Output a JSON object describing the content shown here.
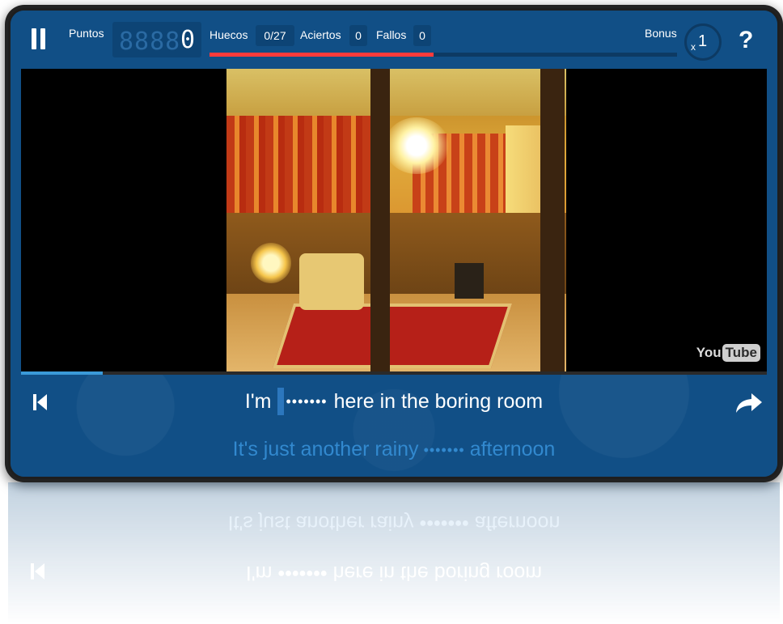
{
  "header": {
    "points_label": "Puntos",
    "points_ghost": "8888",
    "points_value": "0",
    "gaps_label": "Huecos",
    "gaps_value": "0/27",
    "hits_label": "Aciertos",
    "hits_value": "0",
    "misses_label": "Fallos",
    "misses_value": "0",
    "bonus_label": "Bonus",
    "bonus_prefix": "x",
    "bonus_value": "1",
    "help_label": "?"
  },
  "video": {
    "logo_you": "You",
    "logo_tube": "Tube",
    "playback_progress": 0.11
  },
  "timer": {
    "progress": 0.48
  },
  "lyrics": {
    "current_before": "I'm",
    "current_gap": "•••••••",
    "current_after": "here in the boring room",
    "next_before": "It's just another rainy",
    "next_gap": "•••••••",
    "next_after": "afternoon"
  },
  "colors": {
    "panel": "#114f86",
    "timer_bar": "#ff3b3b",
    "next_line": "#3289cf",
    "video_progress": "#3b9ad9"
  },
  "icons": {
    "pause": "pause-icon",
    "previous": "skip-back-icon",
    "share": "share-arrow-icon",
    "help": "question-icon"
  }
}
